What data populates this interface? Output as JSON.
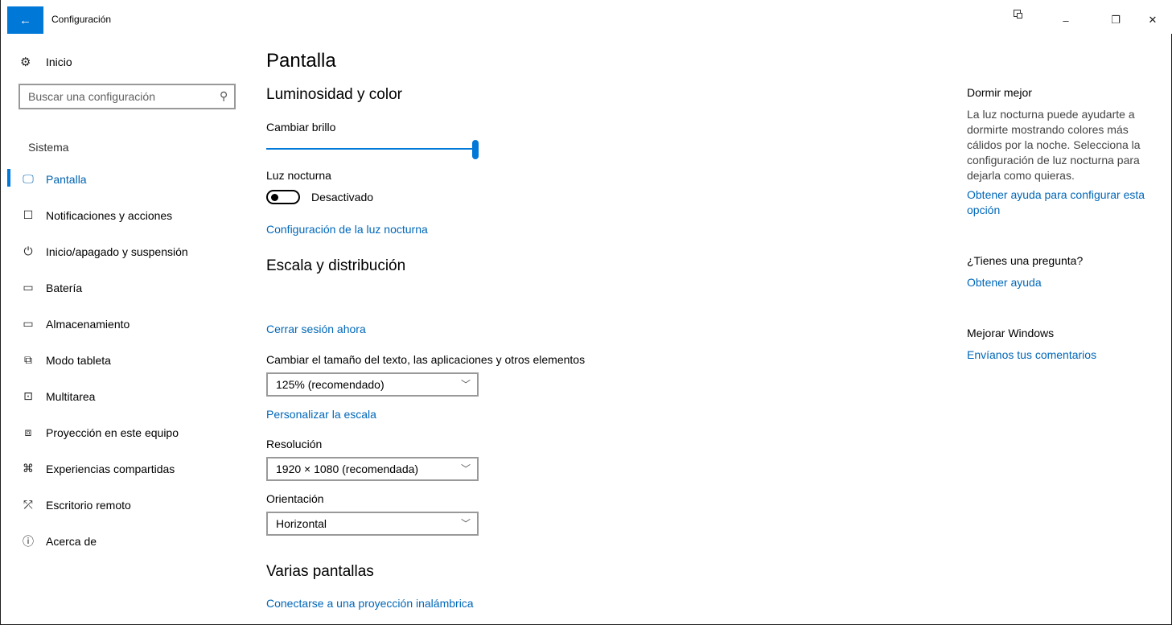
{
  "window": {
    "title": "Configuración",
    "back_glyph": "←",
    "minimize_glyph": "–",
    "restore_glyph": "❐",
    "close_glyph": "✕"
  },
  "sidebar": {
    "home_label": "Inicio",
    "search_placeholder": "Buscar una configuración",
    "group_label": "Sistema",
    "items": [
      {
        "label": "Pantalla",
        "icon": "monitor-icon",
        "glyph": "🖵"
      },
      {
        "label": "Notificaciones y acciones",
        "icon": "notification-icon",
        "glyph": "☐"
      },
      {
        "label": "Inicio/apagado y suspensión",
        "icon": "power-icon",
        "glyph": "⏻"
      },
      {
        "label": "Batería",
        "icon": "battery-icon",
        "glyph": "▭"
      },
      {
        "label": "Almacenamiento",
        "icon": "storage-icon",
        "glyph": "▭"
      },
      {
        "label": "Modo tableta",
        "icon": "tablet-icon",
        "glyph": "⧉"
      },
      {
        "label": "Multitarea",
        "icon": "multitask-icon",
        "glyph": "⊡"
      },
      {
        "label": "Proyección en este equipo",
        "icon": "projection-icon",
        "glyph": "⧈"
      },
      {
        "label": "Experiencias compartidas",
        "icon": "shared-icon",
        "glyph": "⌘"
      },
      {
        "label": "Escritorio remoto",
        "icon": "remote-icon",
        "glyph": "⤱"
      },
      {
        "label": "Acerca de",
        "icon": "info-icon",
        "glyph": "ⓘ"
      }
    ],
    "active_index": 0
  },
  "main": {
    "title": "Pantalla",
    "brightness_section": "Luminosidad y color",
    "brightness_label": "Cambiar brillo",
    "brightness_value": 1.0,
    "night_light_label": "Luz nocturna",
    "night_light_state": "Desactivado",
    "night_light_settings_link": "Configuración de la luz nocturna",
    "scale_section": "Escala y distribución",
    "sign_out_link": "Cerrar sesión ahora",
    "scale_label": "Cambiar el tamaño del texto, las aplicaciones y otros elementos",
    "scale_value": "125% (recomendado)",
    "custom_scale_link": "Personalizar la escala",
    "resolution_label": "Resolución",
    "resolution_value": "1920 × 1080 (recomendada)",
    "orientation_label": "Orientación",
    "orientation_value": "Horizontal",
    "multi_display_section": "Varias pantallas",
    "wireless_link": "Conectarse a una proyección inalámbrica"
  },
  "right_panel": {
    "sleep_heading": "Dormir mejor",
    "sleep_text": "La luz nocturna puede ayudarte a dormirte mostrando colores más cálidos por la noche. Selecciona la configuración de luz nocturna para dejarla como quieras.",
    "sleep_link": "Obtener ayuda para configurar esta opción",
    "question_heading": "¿Tienes una pregunta?",
    "question_link": "Obtener ayuda",
    "improve_heading": "Mejorar Windows",
    "improve_link": "Envíanos tus comentarios"
  },
  "colors": {
    "accent": "#0078d7",
    "link": "#0067b8"
  }
}
